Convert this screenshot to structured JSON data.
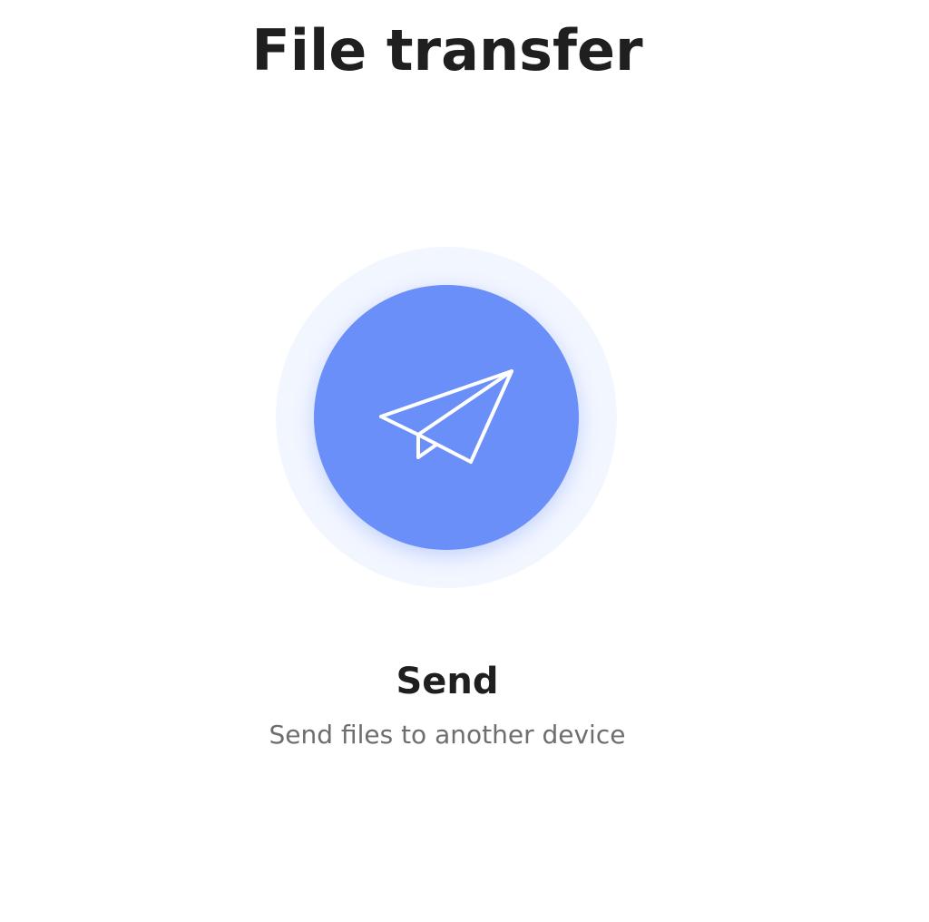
{
  "header": {
    "title": "File transfer"
  },
  "send": {
    "label": "Send",
    "description": "Send files to another device",
    "icon": "paper-plane-icon",
    "circle_color": "#6b8ff8",
    "halo_color": "#f2f6ff"
  }
}
